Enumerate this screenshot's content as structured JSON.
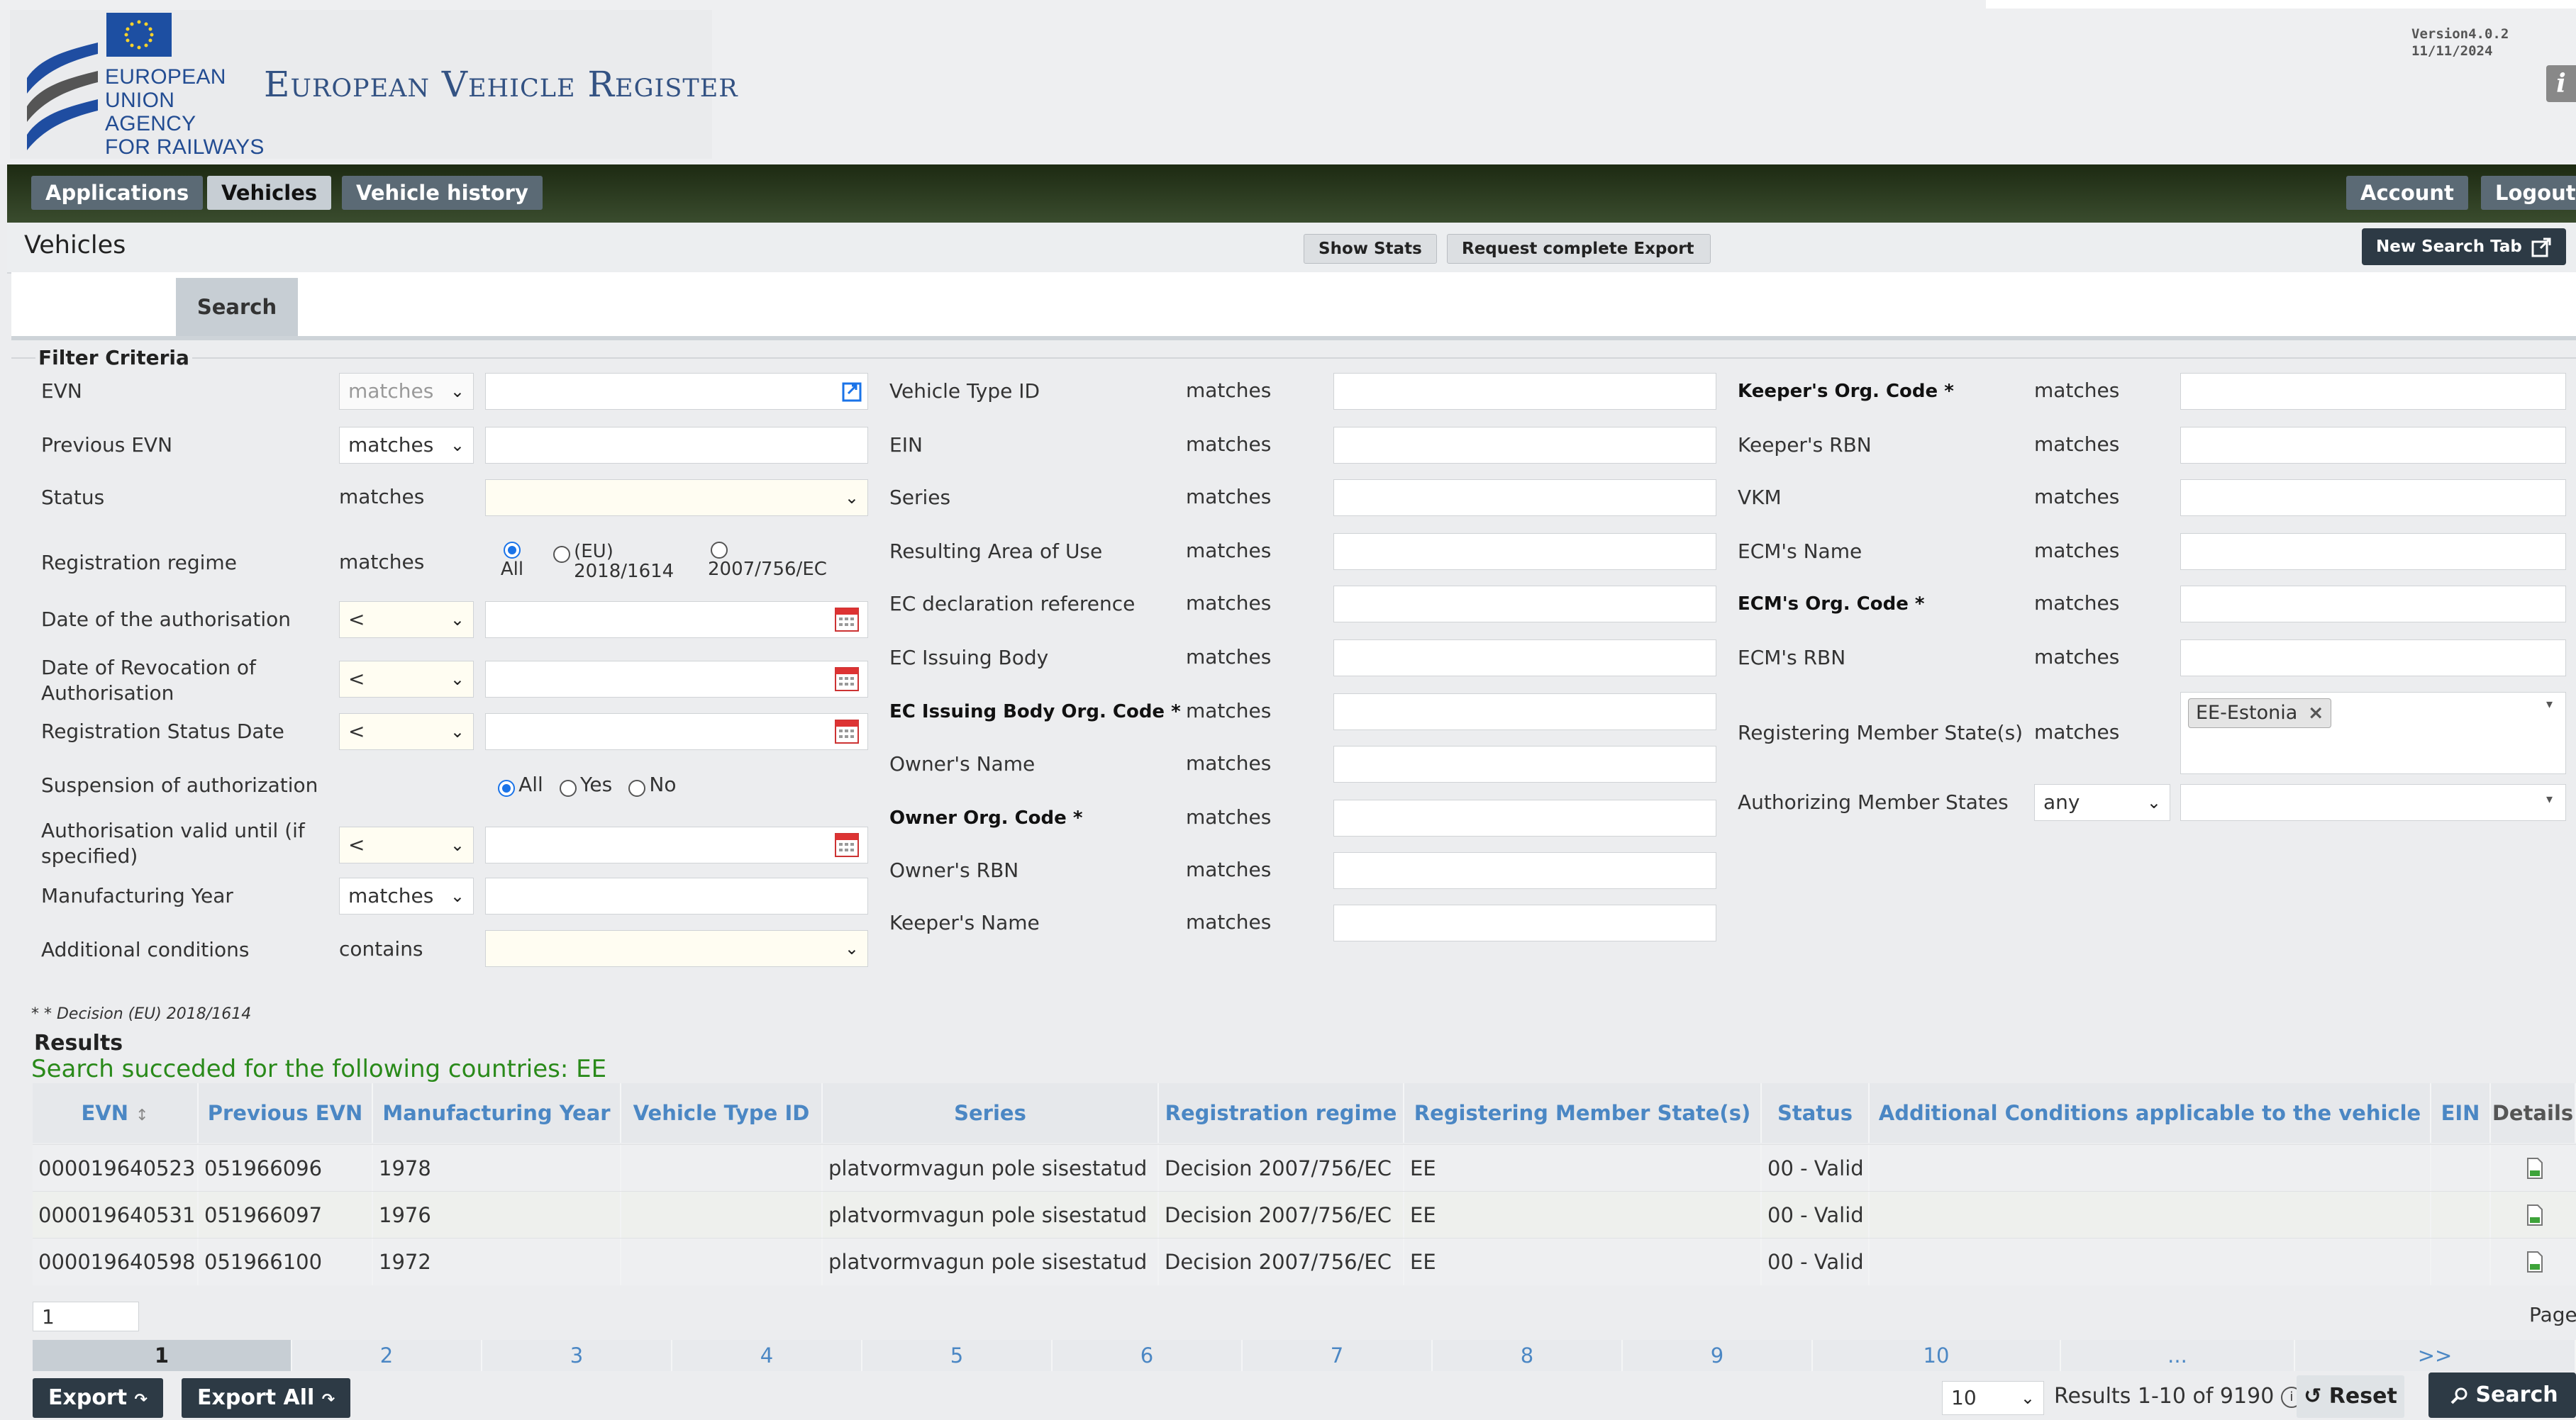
{
  "header": {
    "agency_lines": [
      "EUROPEAN",
      "UNION",
      "AGENCY",
      "FOR RAILWAYS"
    ],
    "app_title": "European Vehicle Register",
    "version_line1": "Version4.0.2",
    "version_line2": "11/11/2024",
    "info_glyph": "i"
  },
  "nav": {
    "left": [
      "Applications",
      "Vehicles",
      "Vehicle history"
    ],
    "active": "Vehicles",
    "right": [
      "Account",
      "Logout"
    ]
  },
  "titlebar": {
    "title": "Vehicles",
    "show_stats": "Show Stats",
    "request_export": "Request complete Export",
    "new_search_tab": "New Search Tab"
  },
  "tabs": {
    "search": "Search"
  },
  "filter": {
    "legend": "Filter Criteria",
    "col1": [
      {
        "label": "EVN",
        "op": "matches"
      },
      {
        "label": "Previous EVN",
        "op": "matches"
      },
      {
        "label": "Status",
        "op": "matches"
      },
      {
        "label": "Registration regime",
        "op": "matches"
      },
      {
        "label": "Date of the authorisation",
        "op": "<"
      },
      {
        "label": "Date of Revocation of Authorisation",
        "op": "<"
      },
      {
        "label": "Registration Status Date",
        "op": "<"
      },
      {
        "label": "Suspension of authorization",
        "op": ""
      },
      {
        "label": "Authorisation valid until (if specified)",
        "op": "<"
      },
      {
        "label": "Manufacturing Year",
        "op": "matches"
      },
      {
        "label": "Additional conditions",
        "op": "contains"
      }
    ],
    "regime_options": [
      "All",
      "(EU) 2018/1614",
      "2007/756/EC"
    ],
    "suspension_options": [
      "All",
      "Yes",
      "No"
    ],
    "col2": [
      {
        "label": "Vehicle Type ID",
        "op": "matches",
        "bold": false
      },
      {
        "label": "EIN",
        "op": "matches",
        "bold": false
      },
      {
        "label": "Series",
        "op": "matches",
        "bold": false
      },
      {
        "label": "Resulting Area of Use",
        "op": "matches",
        "bold": false
      },
      {
        "label": "EC declaration reference",
        "op": "matches",
        "bold": false
      },
      {
        "label": "EC Issuing Body",
        "op": "matches",
        "bold": false
      },
      {
        "label": "EC Issuing Body Org. Code *",
        "op": "matches",
        "bold": true
      },
      {
        "label": "Owner's Name",
        "op": "matches",
        "bold": false
      },
      {
        "label": "Owner Org. Code *",
        "op": "matches",
        "bold": true
      },
      {
        "label": "Owner's RBN",
        "op": "matches",
        "bold": false
      },
      {
        "label": "Keeper's Name",
        "op": "matches",
        "bold": false
      }
    ],
    "col3": [
      {
        "label": "Keeper's Org. Code *",
        "op": "matches",
        "bold": true
      },
      {
        "label": "Keeper's RBN",
        "op": "matches",
        "bold": false
      },
      {
        "label": "VKM",
        "op": "matches",
        "bold": false
      },
      {
        "label": "ECM's Name",
        "op": "matches",
        "bold": false
      },
      {
        "label": "ECM's Org. Code *",
        "op": "matches",
        "bold": true
      },
      {
        "label": "ECM's RBN",
        "op": "matches",
        "bold": false
      },
      {
        "label": "Registering Member State(s)",
        "op": "matches",
        "bold": false
      },
      {
        "label": "Authorizing Member States",
        "op": "any",
        "bold": false
      }
    ],
    "member_state_tag": "EE-Estonia",
    "note": "* * Decision (EU) 2018/1614"
  },
  "results": {
    "title": "Results",
    "success": "Search succeded for the following countries: EE",
    "columns": [
      "EVN",
      "Previous EVN",
      "Manufacturing Year",
      "Vehicle Type ID",
      "Series",
      "Registration regime",
      "Registering Member State(s)",
      "Status",
      "Additional Conditions applicable to the vehicle",
      "EIN",
      "Details"
    ],
    "rows": [
      [
        "000019640523",
        "051966096",
        "1978",
        "",
        "platvormvagun pole sisestatud",
        "Decision 2007/756/EC",
        "EE",
        "00 - Valid",
        "",
        ""
      ],
      [
        "000019640531",
        "051966097",
        "1976",
        "",
        "platvormvagun pole sisestatud",
        "Decision 2007/756/EC",
        "EE",
        "00 - Valid",
        "",
        ""
      ],
      [
        "000019640598",
        "051966100",
        "1972",
        "",
        "platvormvagun pole sisestatud",
        "Decision 2007/756/EC",
        "EE",
        "00 - Valid",
        "",
        ""
      ]
    ],
    "page_input": "1",
    "page_label": "Page",
    "pages": [
      "1",
      "2",
      "3",
      "4",
      "5",
      "6",
      "7",
      "8",
      "9",
      "10",
      "...",
      ">>"
    ],
    "current_page": "1",
    "page_size": "10",
    "count_text": "Results 1-10 of 9190"
  },
  "footer": {
    "export": "Export",
    "export_all": "Export All",
    "reset": "Reset",
    "search": "Search"
  },
  "colors": {
    "nav_bg": "#2a3a1f",
    "link_blue": "#4b87c4",
    "success_green": "#2a8a1a"
  }
}
